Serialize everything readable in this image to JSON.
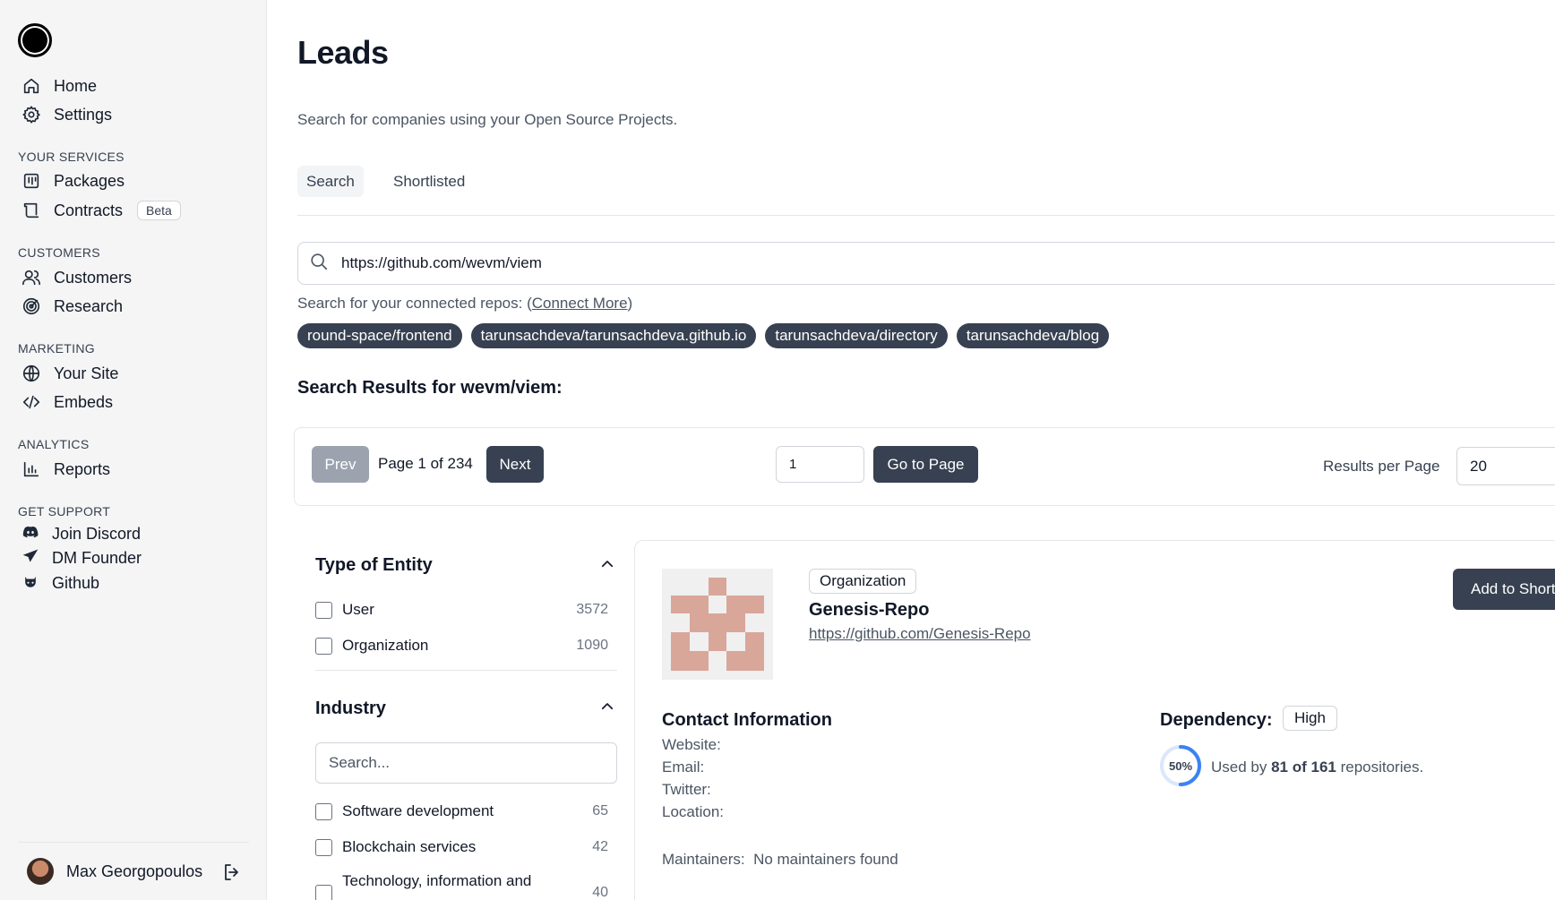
{
  "sidebar": {
    "nav": [
      {
        "label": "Home",
        "icon": "home-icon"
      },
      {
        "label": "Settings",
        "icon": "gear-icon"
      }
    ],
    "sections": [
      {
        "label": "YOUR SERVICES",
        "items": [
          {
            "label": "Packages",
            "icon": "package-icon"
          },
          {
            "label": "Contracts",
            "icon": "contract-icon",
            "badge": "Beta"
          }
        ]
      },
      {
        "label": "CUSTOMERS",
        "items": [
          {
            "label": "Customers",
            "icon": "users-icon"
          },
          {
            "label": "Research",
            "icon": "target-icon"
          }
        ]
      },
      {
        "label": "MARKETING",
        "items": [
          {
            "label": "Your Site",
            "icon": "globe-icon"
          },
          {
            "label": "Embeds",
            "icon": "code-icon"
          }
        ]
      },
      {
        "label": "ANALYTICS",
        "items": [
          {
            "label": "Reports",
            "icon": "bar-chart-icon"
          }
        ]
      },
      {
        "label": "GET SUPPORT",
        "items": [
          {
            "label": "Join Discord",
            "icon": "discord-icon"
          },
          {
            "label": "DM Founder",
            "icon": "send-icon"
          },
          {
            "label": "Github",
            "icon": "github-icon"
          }
        ]
      }
    ],
    "user": {
      "name": "Max Georgopoulos"
    }
  },
  "page": {
    "title": "Leads",
    "subtitle": "Search for companies using your Open Source Projects.",
    "tabs": [
      {
        "label": "Search",
        "active": true
      },
      {
        "label": "Shortlisted",
        "active": false
      }
    ]
  },
  "search": {
    "value": "https://github.com/wevm/viem",
    "connected_prefix": "Search for your connected repos: (",
    "connect_more": "Connect More",
    "connected_suffix": ")",
    "repos": [
      "round-space/frontend",
      "tarunsachdeva/tarunsachdeva.github.io",
      "tarunsachdeva/directory",
      "tarunsachdeva/blog"
    ]
  },
  "results": {
    "title": "Search Results for wevm/viem:"
  },
  "pagination": {
    "prev": "Prev",
    "page_info": "Page 1 of 234",
    "next": "Next",
    "page_input": "1",
    "go": "Go to Page",
    "rpp_label": "Results per Page",
    "rpp_value": "20"
  },
  "filters": {
    "entity": {
      "title": "Type of Entity",
      "options": [
        {
          "label": "User",
          "count": "3572"
        },
        {
          "label": "Organization",
          "count": "1090"
        }
      ]
    },
    "industry": {
      "title": "Industry",
      "placeholder": "Search...",
      "options": [
        {
          "label": "Software development",
          "count": "65"
        },
        {
          "label": "Blockchain services",
          "count": "42"
        },
        {
          "label": "Technology, information and",
          "count": "40"
        }
      ]
    }
  },
  "card": {
    "type": "Organization",
    "name": "Genesis-Repo",
    "url": "https://github.com/Genesis-Repo",
    "add_button": "Add to Shortlist",
    "contact_title": "Contact Information",
    "contact_fields": [
      "Website:",
      "Email:",
      "Twitter:",
      "Location:"
    ],
    "maintainers_label": "Maintainers:",
    "maintainers_value": "No maintainers found",
    "dependency_label": "Dependency:",
    "dependency_level": "High",
    "usage_percent": 50,
    "usage_percent_text": "50%",
    "usage_prefix": "Used by ",
    "usage_count": "81 of 161",
    "usage_suffix": " repositories."
  },
  "colors": {
    "dark_button": "#374151",
    "disabled_button": "#9ca3af",
    "ring": "#3b82f6",
    "identicon": "#d9a69a"
  }
}
